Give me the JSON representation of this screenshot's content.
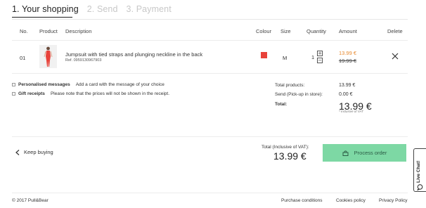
{
  "steps": {
    "step1": "1. Your shopping",
    "step2": "2. Send",
    "step3": "3. Payment"
  },
  "table": {
    "headers": {
      "no": "No.",
      "product": "Product",
      "description": "Description",
      "colour": "Colour",
      "size": "Size",
      "quantity": "Quantity",
      "amount": "Amount",
      "delete": "Delete"
    },
    "row": {
      "no": "01",
      "description": "Jumpsuit with tied straps and plunging neckline in the back",
      "ref": "Ref. 0959130967903",
      "colour": "#e8423a",
      "size": "M",
      "quantity": "1",
      "price": "13.99 €",
      "old_price": "19.99 €"
    }
  },
  "options": {
    "personalised_title": "Personalised messages",
    "personalised_desc": "Add a card with the message of your choice",
    "gift_title": "Gift receipts",
    "gift_desc": "Please note that the prices will not be shown in the receipt."
  },
  "summary": {
    "total_products_label": "Total products:",
    "total_products_value": "13.99 €",
    "send_label": "Send (Pick-up in store):",
    "send_value": "0.00 €",
    "total_label": "Total:",
    "total_value": "13.99 €",
    "inclusive_vat": "* Inclusive of VAT"
  },
  "bottom": {
    "keep_buying": "Keep buying",
    "total_incl_label": "Total (Inclusive of VAT):",
    "total_incl_value": "13.99 €",
    "process_order": "Process order"
  },
  "live_chat": "Live Chat!",
  "footer": {
    "copyright": "© 2017 Pull&Bear",
    "purchase_conditions": "Purchase conditions",
    "cookies_policy": "Cookies policy",
    "privacy_policy": "Privacy Policy"
  },
  "colors": {
    "accent_green": "#7dd8a4",
    "price_orange": "#e8892e",
    "swatch_red": "#e8423a"
  }
}
